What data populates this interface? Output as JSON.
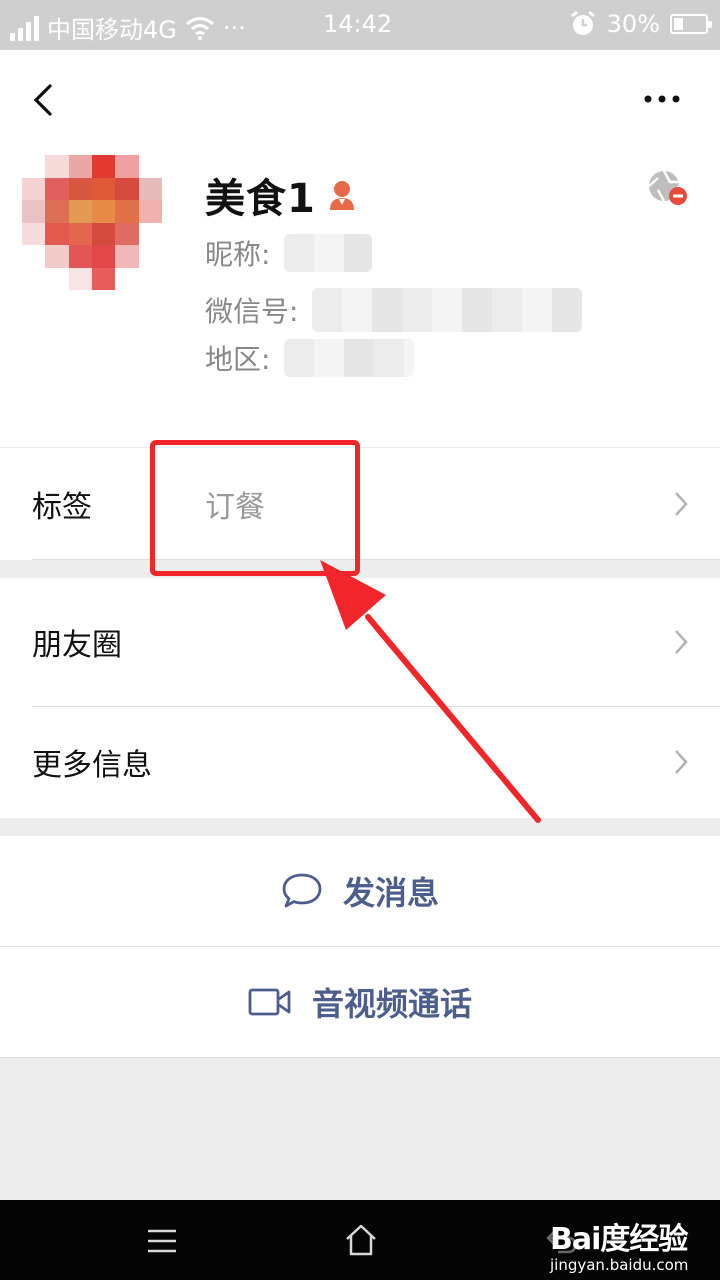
{
  "status_bar": {
    "carrier": "中国移动4G",
    "extra": "···",
    "time": "14:42",
    "battery": "30%"
  },
  "header": {
    "back_icon": "chevron-left-icon",
    "more_icon": "more-dots-icon"
  },
  "profile": {
    "name": "美食1",
    "nickname_label": "昵称:",
    "wechat_id_label": "微信号:",
    "region_label": "地区:"
  },
  "rows": {
    "tags": {
      "label": "标签",
      "value": "订餐"
    },
    "moments": {
      "label": "朋友圈"
    },
    "more_info": {
      "label": "更多信息"
    }
  },
  "actions": {
    "send_message": "发消息",
    "video_call": "音视频通话"
  },
  "watermark": {
    "logo": "Bai度经验",
    "url": "jingyan.baidu.com"
  },
  "colors": {
    "accent_blue": "#4d5e8c",
    "annotation_red": "#f0262b",
    "gender_icon": "#e8694a"
  }
}
